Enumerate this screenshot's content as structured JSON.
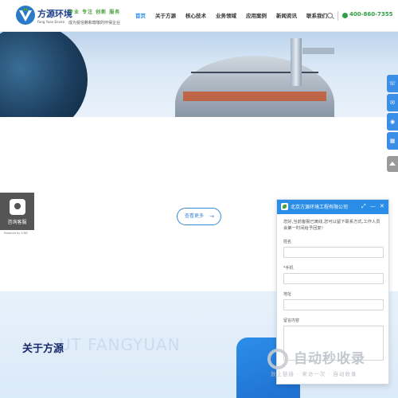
{
  "header": {
    "logo_cn": "方源环境",
    "logo_en": "Fang Yuan Enviro",
    "slogan": "专业 专注 创新 服务",
    "slogan_sub": "成为受信赖和尊敬的环保企业",
    "nav": [
      "首页",
      "关于方源",
      "核心技术",
      "业务领域",
      "应用案例",
      "新闻资讯",
      "联系我们"
    ],
    "active_nav": "首页",
    "phone": "400-860-7355"
  },
  "main": {
    "more_button": "查看更多"
  },
  "consult": {
    "label": "咨询客服",
    "powered": "Powered by 53KF"
  },
  "about": {
    "title": "关于方源",
    "bg_text": "UT FANGYUAN"
  },
  "chat": {
    "title": "北京方源环境工程有限公司",
    "message": "您好,当前客服已离线,您可以留下联系方式,工作人员会第一时间给予回复！",
    "fields": [
      "姓名",
      "*手机",
      "地址",
      "留言内容"
    ]
  },
  "watermark": {
    "text": "自动秒收录",
    "sub": "放上链接 · 来访一次 · 自动收录"
  },
  "colors": {
    "primary": "#2a8ee8",
    "green": "#2f9e44",
    "navy": "#1a2a6a"
  }
}
